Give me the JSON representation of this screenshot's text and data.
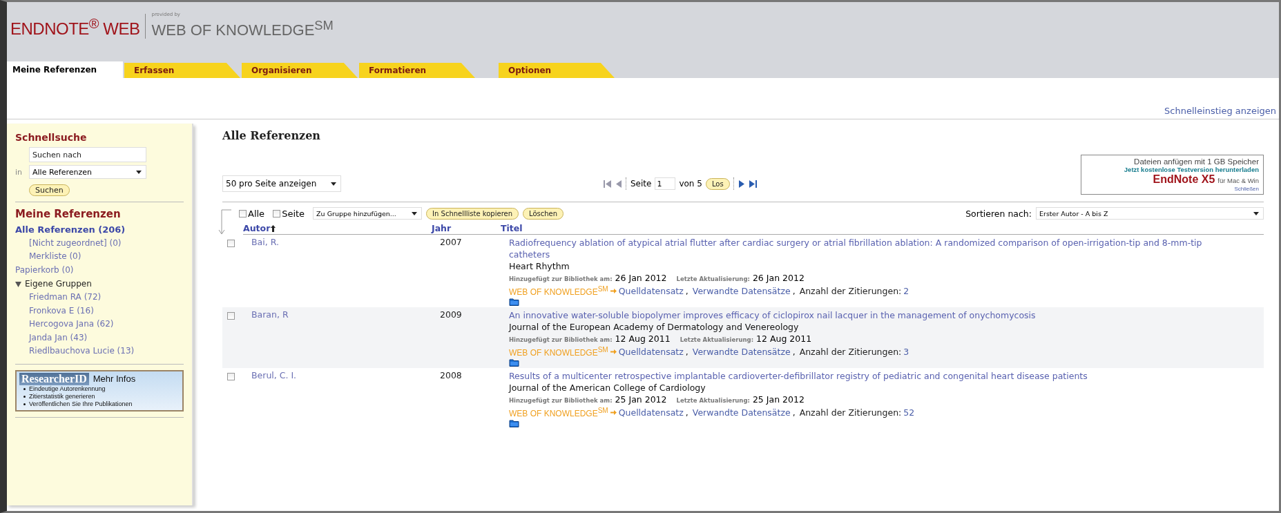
{
  "header": {
    "brand": "ENDNOTE$^{®}$ WEB",
    "provided_by": "provided by",
    "partner": "WEB OF KNOWLEDGE$^{SM}$"
  },
  "tabs": [
    {
      "label": "Meine Referenzen",
      "selected": true
    },
    {
      "label": "Erfassen",
      "selected": false
    },
    {
      "label": "Organisieren",
      "selected": false
    },
    {
      "label": "Formatieren",
      "selected": false
    },
    {
      "label": "Optionen",
      "selected": false
    }
  ],
  "quick_start_link": "Schnelleinstieg anzeigen",
  "sidebar": {
    "quick_search": {
      "title": "Schnellsuche",
      "placeholder": "Suchen nach",
      "in_label": "in",
      "scope": "Alle Referenzen",
      "button": "Suchen"
    },
    "my_references": {
      "title": "Meine Referenzen",
      "items": [
        {
          "kind": "link",
          "label": "Alle Referenzen (206)",
          "selected": true,
          "children": [
            {
              "label": "[Nicht zugeordnet] (0)",
              "selected": false
            },
            {
              "label": "Merkliste (0)",
              "selected": false
            }
          ]
        },
        {
          "kind": "link",
          "label": "Papierkorb (0)",
          "selected": false
        },
        {
          "kind": "group",
          "label": "Eigene Gruppen",
          "expanded": true,
          "children": [
            {
              "label": "Friedman RA (72)",
              "selected": false
            },
            {
              "label": "Fronkova E (16)",
              "selected": false
            },
            {
              "label": "Hercogova Jana (62)",
              "selected": false
            },
            {
              "label": "Janda Jan (43)",
              "selected": false
            },
            {
              "label": "Riedlbauchova Lucie (13)",
              "selected": false
            }
          ]
        }
      ]
    },
    "researcher_id": {
      "logo": "ResearcherID",
      "link": "Mehr Infos",
      "bullets": [
        "Eindeutige Autorenkennung",
        "Zitierstatistik generieren",
        "Veröffentlichen Sie Ihre Publikationen"
      ]
    }
  },
  "main": {
    "title": "Alle Referenzen",
    "per_page": "50 pro Seite anzeigen",
    "pager": {
      "page_label": "Seite",
      "page": "1",
      "of_label": "von 5",
      "go": "Los"
    },
    "promo": {
      "line1": "Dateien anfügen mit 1 GB Speicher",
      "line2": "Jetzt kostenlose Testversion herunterladen",
      "brand": "EndNote X5",
      "brand_suffix": "für Mac & Win",
      "close": "Schließen"
    },
    "toolbar": {
      "all_label": "Alle",
      "all_checked": false,
      "page_label": "Seite",
      "page_checked": false,
      "group_select": "Zu Gruppe hinzufügen...",
      "copy_button": "In Schnellliste kopieren",
      "delete_button": "Löschen"
    },
    "sort": {
      "label": "Sortieren nach:",
      "value": "Erster Autor - A bis Z"
    },
    "columns": [
      {
        "label": "Autor",
        "sorted": true
      },
      {
        "label": "Jahr",
        "sorted": false
      },
      {
        "label": "Titel",
        "sorted": false
      }
    ],
    "rows": [
      {
        "checked": false,
        "author": "Bai, R.",
        "year": "2007",
        "title": "Radiofrequency ablation of atypical atrial flutter after cardiac surgery or atrial fibrillation ablation: A randomized comparison of open-irrigation-tip and 8-mm-tip catheters",
        "journal": "Heart Rhythm",
        "added_label": "Hinzugefügt zur Bibliothek am:",
        "added": "26 Jan 2012",
        "updated_label": "Letzte Aktualisierung:",
        "updated": "26 Jan 2012",
        "wok": "WEB OF KNOWLEDGE$^{SM}$",
        "source_link": "Quelldatensatz",
        "separator": ",",
        "related_link": "Verwandte Datensätze",
        "separator_2": ",",
        "cites_label": "Anzahl der Zitierungen:",
        "cites": "2"
      },
      {
        "checked": false,
        "author": "Baran, R",
        "year": "2009",
        "title": "An innovative water-soluble biopolymer improves efficacy of ciclopirox nail lacquer in the management of onychomycosis",
        "journal": "Journal of the European Academy of Dermatology and Venereology",
        "added_label": "Hinzugefügt zur Bibliothek am:",
        "added": "12 Aug 2011",
        "updated_label": "Letzte Aktualisierung:",
        "updated": "12 Aug 2011",
        "wok": "WEB OF KNOWLEDGE$^{SM}$",
        "source_link": "Quelldatensatz",
        "separator": ",",
        "related_link": "Verwandte Datensätze",
        "separator_2": ",",
        "cites_label": "Anzahl der Zitierungen:",
        "cites": "3"
      },
      {
        "checked": false,
        "author": "Berul, C. I.",
        "year": "2008",
        "title": "Results of a multicenter retrospective implantable cardioverter-defibrillator registry of pediatric and congenital heart disease patients",
        "journal": "Journal of the American College of Cardiology",
        "added_label": "Hinzugefügt zur Bibliothek am:",
        "added": "25 Jan 2012",
        "updated_label": "Letzte Aktualisierung:",
        "updated": "25 Jan 2012",
        "wok": "WEB OF KNOWLEDGE$^{SM}$",
        "source_link": "Quelldatensatz",
        "separator": ",",
        "related_link": "Verwandte Datensätze",
        "separator_2": ",",
        "cites_label": "Anzahl der Zitierungen:",
        "cites": "52"
      }
    ]
  }
}
